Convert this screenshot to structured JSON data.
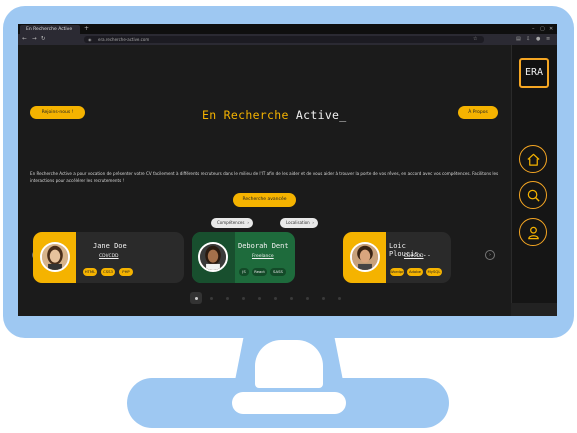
{
  "browser": {
    "tab_title": "En Recherche Active",
    "tab_close": "×",
    "new_tab": "+",
    "url": "era.recherche-active.com",
    "nav_back": "←",
    "nav_forward": "→",
    "nav_reload": "↻"
  },
  "header": {
    "join_label": "Rejoins-nous !",
    "title_accent": "En Recherche",
    "title_rest": "Active_",
    "about_label": "À Propos"
  },
  "description": "En Recherche Active a pour vocation de présenter votre CV facilement à différents recruteurs dans le milieu de l'IT afin de les aider et de vous aider à trouver la porte de vos rêves, en accord avec vos compétences. Facilitons les interactions pour accélérer les recrutements !",
  "search": {
    "button_label": "Recherche avancée"
  },
  "filters": [
    {
      "label": "Compétences"
    },
    {
      "label": "Localisation"
    }
  ],
  "carousel": {
    "prev_label": "‹",
    "next_label": "›",
    "cards": [
      {
        "name": "Jane Doe",
        "role": "CDI/CDD",
        "tags": [
          "HTML",
          "CSS3",
          "PHP"
        ],
        "theme": "#f5b300"
      },
      {
        "name": "Deborah Dent",
        "role": "Freelance",
        "tags": [
          "JS",
          "React",
          "SASS"
        ],
        "theme": "#1e6b3c"
      },
      {
        "name": "Loic Ploucis...",
        "role": "CDI/CDD",
        "tags": [
          "Wordpress",
          "Adobe",
          "MySQL"
        ],
        "theme": "#f5b300"
      }
    ],
    "page_count": 10,
    "active_page": 0
  },
  "sidebar": {
    "logo_text": "ERA",
    "buttons": [
      {
        "icon": "home-icon"
      },
      {
        "icon": "search-icon"
      },
      {
        "icon": "user-icon"
      }
    ]
  },
  "colors": {
    "accent": "#f5b300",
    "green_card": "#1e6b3c",
    "page_bg": "#1b1b1b",
    "monitor": "#9ec8f2"
  }
}
